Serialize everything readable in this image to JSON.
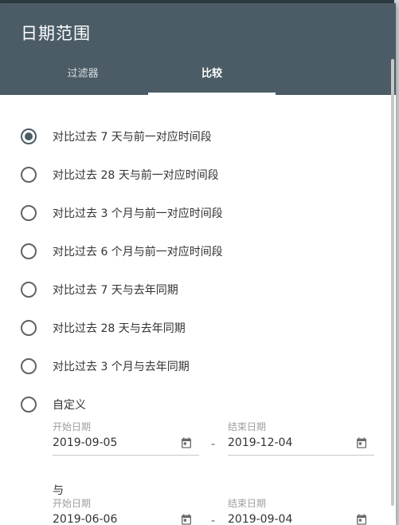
{
  "dialog": {
    "title": "日期范围"
  },
  "tabs": [
    {
      "label": "过滤器",
      "active": false
    },
    {
      "label": "比较",
      "active": true
    }
  ],
  "options": [
    {
      "label": "对比过去 7 天与前一对应时间段",
      "selected": true
    },
    {
      "label": "对比过去 28 天与前一对应时间段",
      "selected": false
    },
    {
      "label": "对比过去 3 个月与前一对应时间段",
      "selected": false
    },
    {
      "label": "对比过去 6 个月与前一对应时间段",
      "selected": false
    },
    {
      "label": "对比过去 7 天与去年同期",
      "selected": false
    },
    {
      "label": "对比过去 28 天与去年同期",
      "selected": false
    },
    {
      "label": "对比过去 3 个月与去年同期",
      "selected": false
    },
    {
      "label": "自定义",
      "selected": false
    }
  ],
  "custom": {
    "range1": {
      "start_label": "开始日期",
      "start_value": "2019-09-05",
      "end_label": "结束日期",
      "end_value": "2019-12-04"
    },
    "separator": "-",
    "and_label": "与",
    "range2": {
      "start_label": "开始日期",
      "start_value": "2019-06-06",
      "end_label": "结束日期",
      "end_value": "2019-09-04"
    }
  },
  "colors": {
    "header": "#4b5c66",
    "radio_checked": "#4b5c66"
  },
  "icons": {
    "date_picker": "calendar-icon"
  }
}
